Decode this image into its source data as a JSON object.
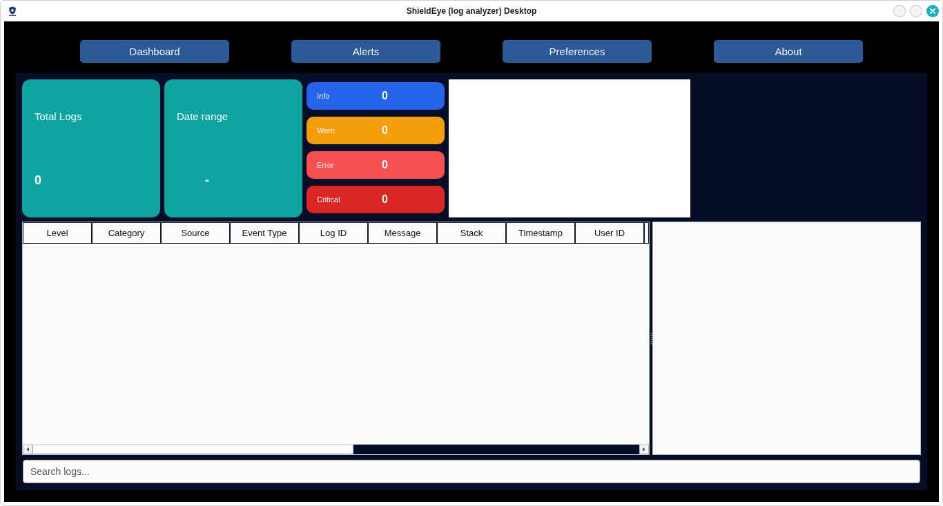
{
  "window": {
    "title": "ShieldEye (log analyzer) Desktop"
  },
  "nav": [
    {
      "label": "Dashboard"
    },
    {
      "label": "Alerts"
    },
    {
      "label": "Preferences"
    },
    {
      "label": "About"
    }
  ],
  "summary_cards": [
    {
      "kind": "count",
      "label": "Total Logs",
      "value": "0"
    },
    {
      "kind": "range",
      "label": "Date range",
      "value": "-"
    }
  ],
  "levels": [
    {
      "label": "Info",
      "count": "0",
      "color": "#2563eb"
    },
    {
      "label": "Warn",
      "count": "0",
      "color": "#f59e0b"
    },
    {
      "label": "Error",
      "count": "0",
      "color": "#f75050"
    },
    {
      "label": "Critical",
      "count": "0",
      "color": "#dc2626"
    }
  ],
  "table": {
    "columns": [
      "Level",
      "Category",
      "Source",
      "Event Type",
      "Log ID",
      "Message",
      "Stack",
      "Timestamp",
      "User ID"
    ]
  },
  "search": {
    "placeholder": "Search logs..."
  }
}
